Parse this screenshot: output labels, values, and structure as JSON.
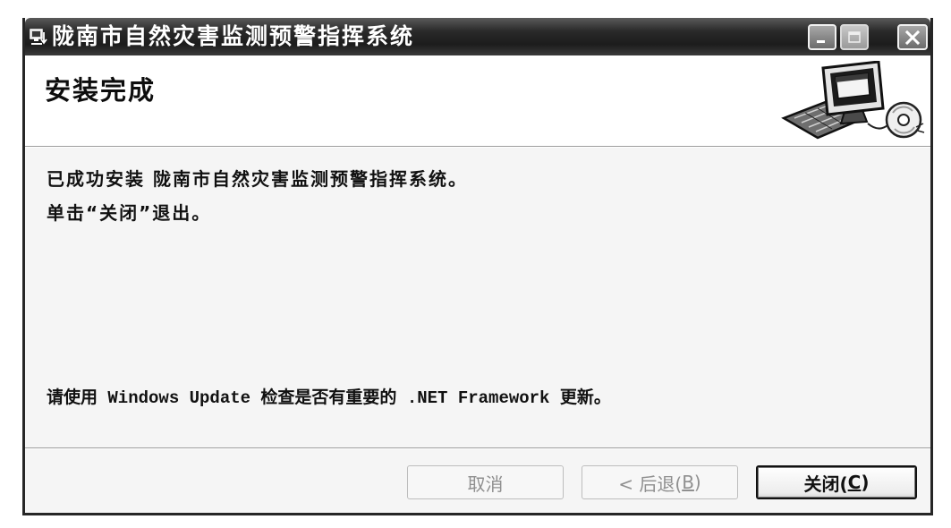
{
  "window": {
    "title": "陇南市自然灾害监测预警指挥系统",
    "title_icon": "installer-icon",
    "controls": {
      "minimize_icon": "minimize-icon",
      "maximize_icon": "maximize-icon",
      "maximize_enabled": false,
      "close_icon": "close-icon"
    }
  },
  "header": {
    "title": "安装完成",
    "icon": "computer-setup-icon"
  },
  "body": {
    "lines": [
      "已成功安装 陇南市自然灾害监测预警指挥系统。",
      "单击“关闭”退出。"
    ],
    "note": "请使用 Windows Update 检查是否有重要的 .NET Framework 更新。"
  },
  "footer": {
    "cancel": {
      "label": "取消",
      "enabled": false
    },
    "back": {
      "before": "< 后退(",
      "accel": "B",
      "after": ")",
      "enabled": false
    },
    "close": {
      "before": "关闭(",
      "accel": "C",
      "after": ")",
      "enabled": true,
      "is_default": true
    }
  },
  "colors": {
    "title_bar": "#2a2a2a",
    "header_bg": "#ffffff",
    "body_bg": "#f5f5f5",
    "disabled_text": "#8f8f8f"
  }
}
